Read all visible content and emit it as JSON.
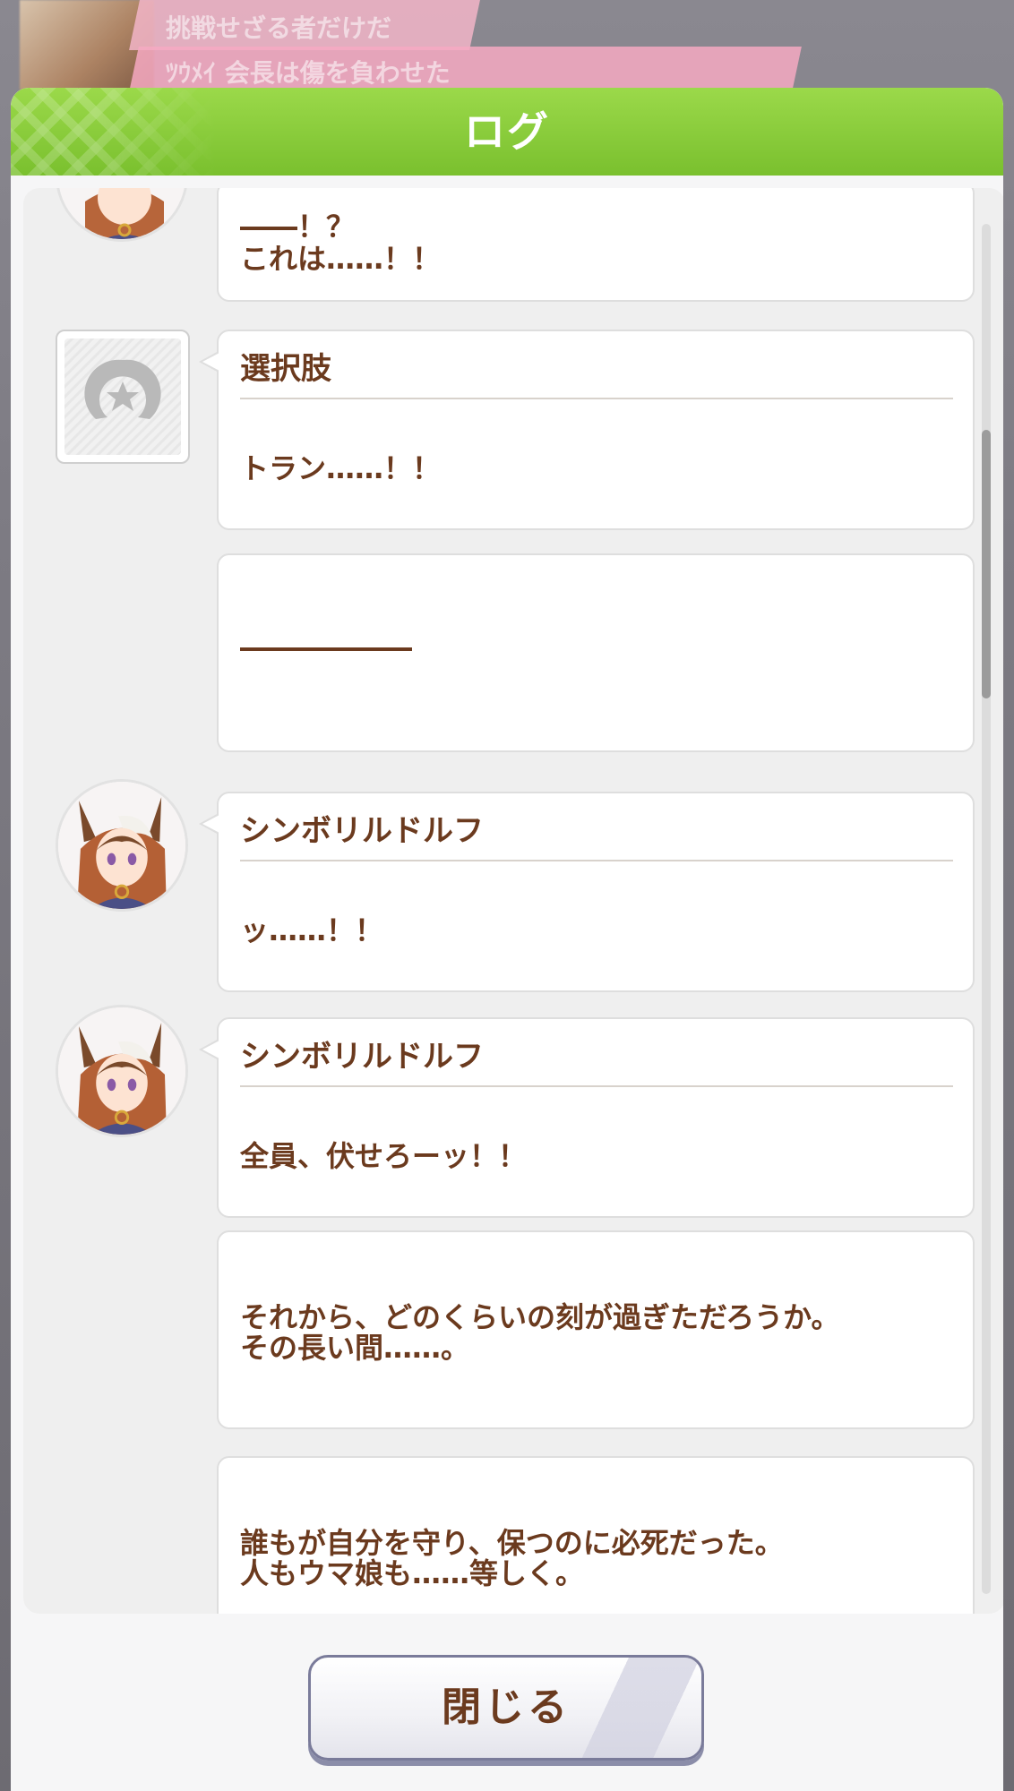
{
  "background": {
    "banner_top": "挑戦せざる者だけだ",
    "banner_bottom": "ﾂｳﾒｲ 会長は傷を負わせた"
  },
  "modal": {
    "title": "ログ",
    "close_label": "閉じる",
    "accent_color": "#7ac02e"
  },
  "log": {
    "entries": [
      {
        "speaker": "",
        "lines": [
          "――！？",
          "これは……！！"
        ],
        "avatar": "symboli-rudolf"
      },
      {
        "speaker": "選択肢",
        "lines": [
          "トラン……！！"
        ],
        "avatar": "horseshoe-placeholder"
      },
      {
        "speaker": "",
        "lines": [
          "――――――"
        ],
        "avatar": ""
      },
      {
        "speaker": "シンボリルドルフ",
        "lines": [
          "ッ……！！"
        ],
        "avatar": "symboli-rudolf"
      },
      {
        "speaker": "シンボリルドルフ",
        "lines": [
          "全員、伏せろーッ！！"
        ],
        "avatar": "symboli-rudolf"
      },
      {
        "speaker": "",
        "lines": [
          "それから、どのくらいの刻が過ぎただろうか。",
          "その長い間……。"
        ],
        "avatar": ""
      },
      {
        "speaker": "",
        "lines": [
          "誰もが自分を守り、保つのに必死だった。",
          "人もウマ娘も……等しく。"
        ],
        "avatar": ""
      }
    ]
  },
  "colors": {
    "text_brown": "#6b3a1e",
    "panel_bg": "#efefef"
  }
}
